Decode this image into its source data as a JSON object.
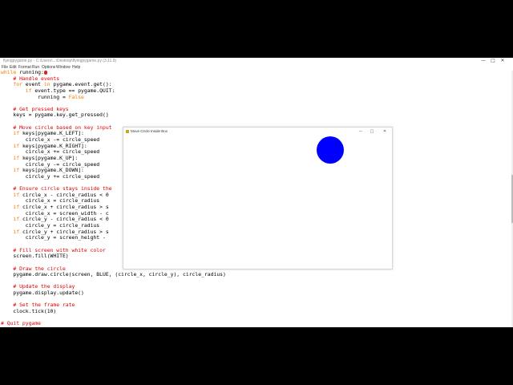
{
  "editor": {
    "title": "flyingpygame.py - C:\\Users\\...\\Desktop\\flyingpygame.py (3.11.9)",
    "window_controls": {
      "minimize": "—",
      "maximize": "□",
      "close": "✕"
    },
    "menu": [
      "File",
      "Edit",
      "Format",
      "Run",
      "Options",
      "Window",
      "Help"
    ],
    "code_lines": [
      [
        [
          "kw",
          "while"
        ],
        [
          "t",
          " running:"
        ],
        [
          "cursor",
          ""
        ]
      ],
      [
        [
          "t",
          "    "
        ],
        [
          "cm",
          "# Handle events"
        ]
      ],
      [
        [
          "t",
          "    "
        ],
        [
          "kw",
          "for"
        ],
        [
          "t",
          " event "
        ],
        [
          "kw",
          "in"
        ],
        [
          "t",
          " pygame.event.get():"
        ]
      ],
      [
        [
          "t",
          "        "
        ],
        [
          "kw",
          "if"
        ],
        [
          "t",
          " event.type == pygame.QUIT:"
        ]
      ],
      [
        [
          "t",
          "            running = "
        ],
        [
          "kw",
          "False"
        ]
      ],
      [
        [
          "t",
          ""
        ]
      ],
      [
        [
          "t",
          "    "
        ],
        [
          "cm",
          "# Get pressed keys"
        ]
      ],
      [
        [
          "t",
          "    keys = pygame.key.get_pressed()"
        ]
      ],
      [
        [
          "t",
          ""
        ]
      ],
      [
        [
          "t",
          "    "
        ],
        [
          "cm",
          "# Move circle based on key input"
        ]
      ],
      [
        [
          "t",
          "    "
        ],
        [
          "kw",
          "if"
        ],
        [
          "t",
          " keys[pygame.K_LEFT]:"
        ]
      ],
      [
        [
          "t",
          "        circle_x -= circle_speed"
        ]
      ],
      [
        [
          "t",
          "    "
        ],
        [
          "kw",
          "if"
        ],
        [
          "t",
          " keys[pygame.K_RIGHT]:"
        ]
      ],
      [
        [
          "t",
          "        circle_x += circle_speed"
        ]
      ],
      [
        [
          "t",
          "    "
        ],
        [
          "kw",
          "if"
        ],
        [
          "t",
          " keys[pygame.K_UP]:"
        ]
      ],
      [
        [
          "t",
          "        circle_y -= circle_speed"
        ]
      ],
      [
        [
          "t",
          "    "
        ],
        [
          "kw",
          "if"
        ],
        [
          "t",
          " keys[pygame.K_DOWN]:"
        ]
      ],
      [
        [
          "t",
          "        circle_y += circle_speed"
        ]
      ],
      [
        [
          "t",
          ""
        ]
      ],
      [
        [
          "t",
          "    "
        ],
        [
          "cm",
          "# Ensure circle stays inside the"
        ]
      ],
      [
        [
          "t",
          "    "
        ],
        [
          "kw",
          "if"
        ],
        [
          "t",
          " circle_x - circle_radius < 0"
        ]
      ],
      [
        [
          "t",
          "        circle_x = circle_radius"
        ]
      ],
      [
        [
          "t",
          "    "
        ],
        [
          "kw",
          "if"
        ],
        [
          "t",
          " circle_x + circle_radius > s"
        ]
      ],
      [
        [
          "t",
          "        circle_x = screen_width - c"
        ]
      ],
      [
        [
          "t",
          "    "
        ],
        [
          "kw",
          "if"
        ],
        [
          "t",
          " circle_y - circle_radius < 0"
        ]
      ],
      [
        [
          "t",
          "        circle_y = circle_radius"
        ]
      ],
      [
        [
          "t",
          "    "
        ],
        [
          "kw",
          "if"
        ],
        [
          "t",
          " circle_y + circle_radius > s"
        ]
      ],
      [
        [
          "t",
          "        circle_y = screen_height - "
        ]
      ],
      [
        [
          "t",
          ""
        ]
      ],
      [
        [
          "t",
          "    "
        ],
        [
          "cm",
          "# Fill screen with white color"
        ]
      ],
      [
        [
          "t",
          "    screen.fill(WHITE)"
        ]
      ],
      [
        [
          "t",
          ""
        ]
      ],
      [
        [
          "t",
          "    "
        ],
        [
          "cm",
          "# Draw the circle"
        ]
      ],
      [
        [
          "t",
          "    pygame.draw.circle(screen, BLUE, (circle_x, circle_y), circle_radius)"
        ]
      ],
      [
        [
          "t",
          ""
        ]
      ],
      [
        [
          "t",
          "    "
        ],
        [
          "cm",
          "# Update the display"
        ]
      ],
      [
        [
          "t",
          "    pygame.display.update()"
        ]
      ],
      [
        [
          "t",
          ""
        ]
      ],
      [
        [
          "t",
          "    "
        ],
        [
          "cm",
          "# Set the frame rate"
        ]
      ],
      [
        [
          "t",
          "    clock.tick(10)"
        ]
      ],
      [
        [
          "t",
          ""
        ]
      ],
      [
        [
          "cm",
          "# Quit pygame"
        ]
      ]
    ]
  },
  "game_window": {
    "title": "Move Circle Inside Box",
    "window_controls": {
      "minimize": "—",
      "maximize": "□",
      "close": "✕"
    },
    "circle_color": "#0000ff",
    "background": "#ffffff"
  }
}
